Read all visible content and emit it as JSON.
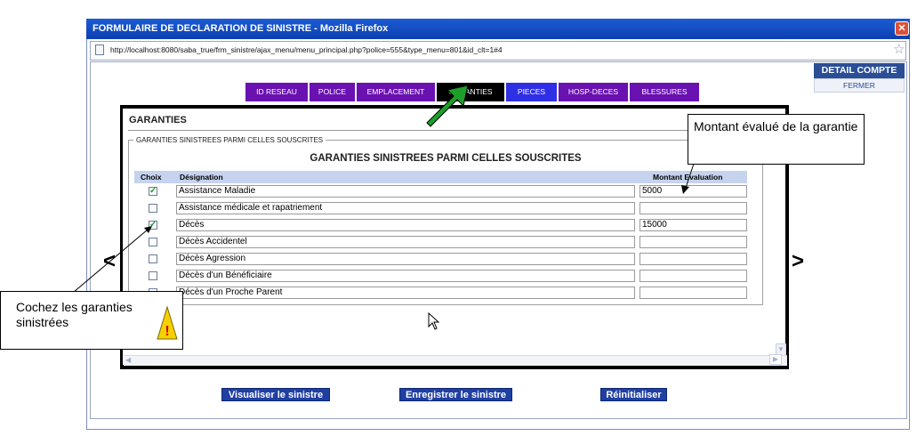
{
  "window": {
    "title": "FORMULAIRE DE DECLARATION DE SINISTRE - Mozilla Firefox",
    "url": "http://localhost:8080/saba_true/frm_sinistre/ajax_menu/menu_principal.php?police=555&type_menu=801&id_clt=1#4",
    "close_glyph": "✕",
    "star_glyph": "☆"
  },
  "side_panel": {
    "detail_label": "DETAIL COMPTE",
    "close_label": "FERMER"
  },
  "tabs": [
    {
      "label": "ID RESEAU"
    },
    {
      "label": "POLICE"
    },
    {
      "label": "EMPLACEMENT"
    },
    {
      "label": "GARANTIES"
    },
    {
      "label": "PIECES"
    },
    {
      "label": "HOSP-DECES"
    },
    {
      "label": "BLESSURES"
    }
  ],
  "section": {
    "heading": "GARANTIES",
    "legend": "GARANTIES SINISTREES PARMI CELLES SOUSCRITES",
    "caption": "GARANTIES SINISTREES PARMI CELLES SOUSCRITES"
  },
  "table": {
    "headers": {
      "choice": "Choix",
      "designation": "Désignation",
      "amount": "Montant Evaluation"
    },
    "rows": [
      {
        "checked": true,
        "designation": "Assistance Maladie",
        "amount": "5000"
      },
      {
        "checked": false,
        "designation": "Assistance médicale et rapatriement",
        "amount": ""
      },
      {
        "checked": true,
        "designation": "Décès",
        "amount": "15000"
      },
      {
        "checked": false,
        "designation": "Décès Accidentel",
        "amount": ""
      },
      {
        "checked": false,
        "designation": "Décès Agression",
        "amount": ""
      },
      {
        "checked": false,
        "designation": "Décès d'un Bénéficiaire",
        "amount": ""
      },
      {
        "checked": false,
        "designation": "Décès d'un Proche Parent",
        "amount": ""
      }
    ]
  },
  "actions": {
    "view": "Visualiser le sinistre",
    "save": "Enregistrer le sinistre",
    "reset": "Réinitialiser"
  },
  "nav": {
    "prev": "<",
    "next": ">"
  },
  "annotations": {
    "amount_callout": "Montant évalué de la garantie",
    "check_callout": "Cochez les garanties sinistrées",
    "warning_glyph": "!"
  },
  "colors": {
    "tab_bg": "#6a11b2",
    "tab_active_bg": "#000000",
    "tab_blue_bg": "#2f2fe5",
    "header_row_bg": "#c6d3ee",
    "button_bg": "#1f3fa3",
    "arrow_green": "#1e9e2a",
    "check_green": "#1d9a2d"
  },
  "icons": {
    "page": "page-icon",
    "bookmark": "star-icon",
    "close": "close-icon",
    "warning": "warning-triangle-icon",
    "cursor": "mouse-pointer-icon"
  }
}
